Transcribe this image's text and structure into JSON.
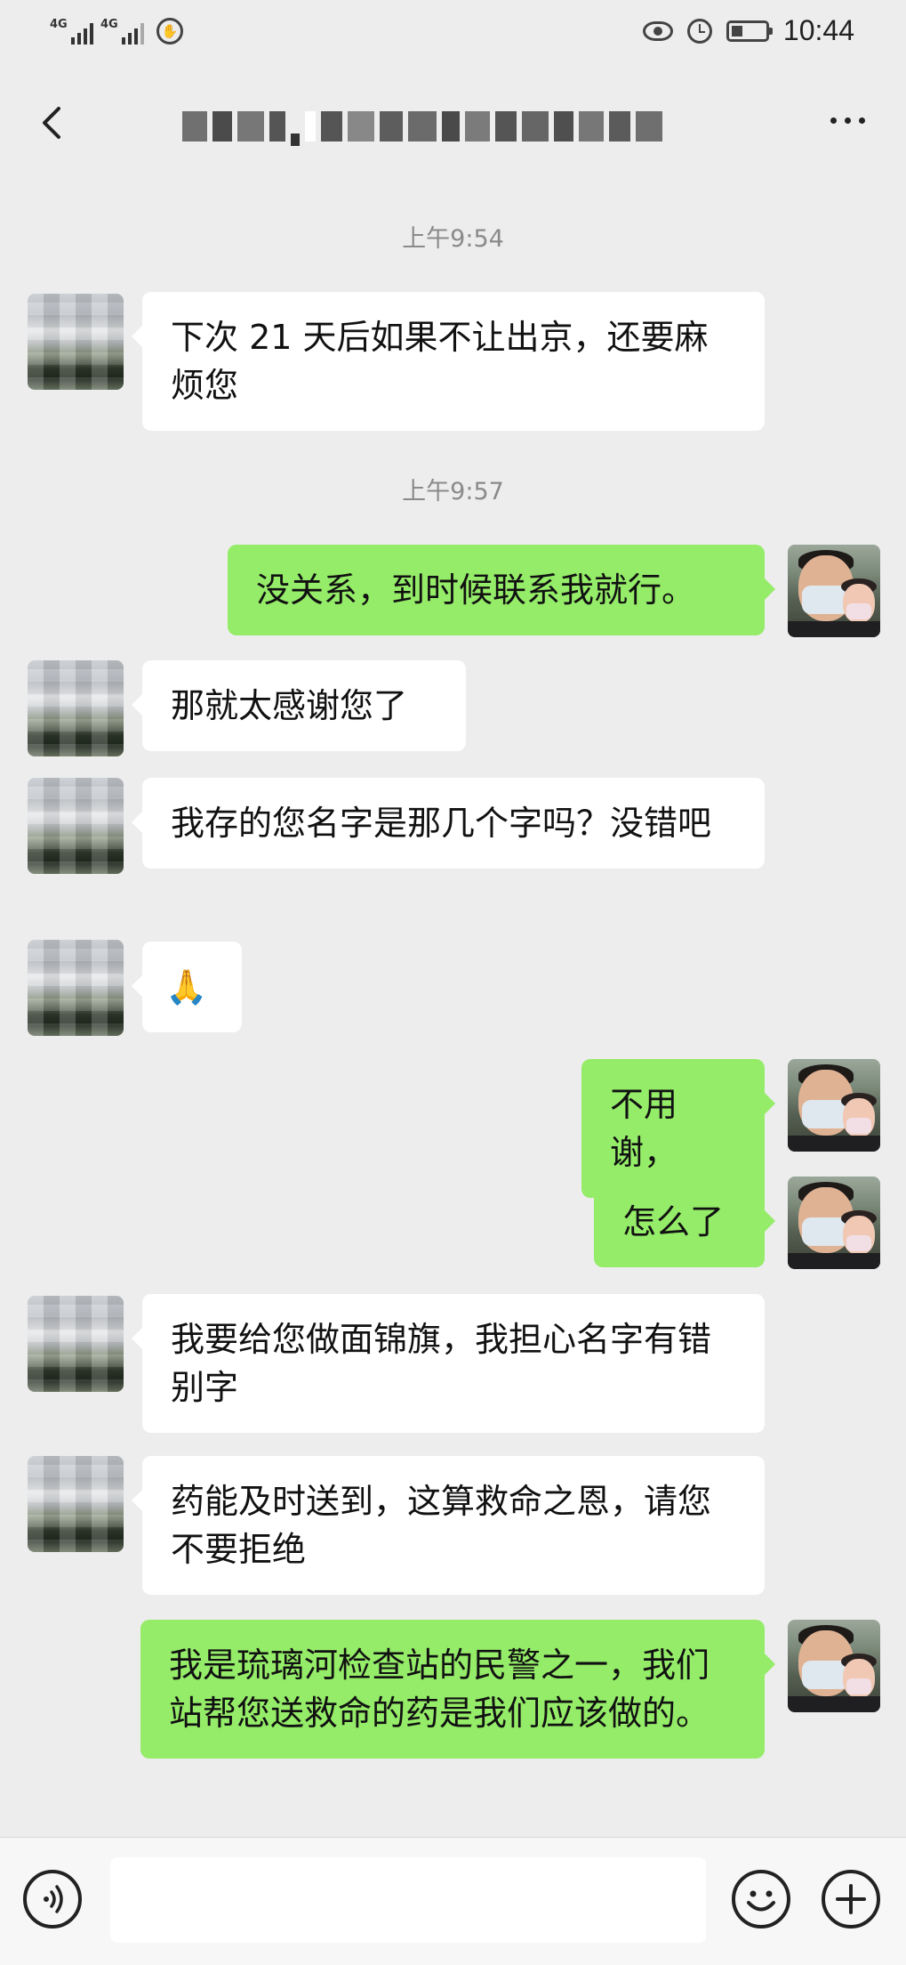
{
  "status_bar": {
    "network_1": "4G",
    "network_2": "4G",
    "time": "10:44"
  },
  "nav": {
    "title": "(blurred contact name)",
    "back_icon": "chevron-left-icon",
    "more_icon": "more-dots-icon"
  },
  "messages": [
    {
      "type": "time",
      "text": "上午9:54"
    },
    {
      "type": "msg",
      "side": "other",
      "text": "下次 21 天后如果不让出京，还要麻烦您"
    },
    {
      "type": "time",
      "text": "上午9:57"
    },
    {
      "type": "msg",
      "side": "self",
      "text": "没关系，到时候联系我就行。"
    },
    {
      "type": "msg",
      "side": "other",
      "text": "那就太感谢您了"
    },
    {
      "type": "msg",
      "side": "other",
      "text": "我存的您名字是那几个字吗？没错吧"
    },
    {
      "type": "msg",
      "side": "other",
      "text": "🙏"
    },
    {
      "type": "msg",
      "side": "self",
      "text": "不用谢，"
    },
    {
      "type": "msg",
      "side": "self",
      "text": "怎么了"
    },
    {
      "type": "msg",
      "side": "other",
      "text": "我要给您做面锦旗，我担心名字有错别字"
    },
    {
      "type": "msg",
      "side": "other",
      "text": "药能及时送到，这算救命之恩，请您不要拒绝"
    },
    {
      "type": "msg",
      "side": "self",
      "text": "我是琉璃河检查站的民警之一，我们站帮您送救命的药是我们应该做的。"
    }
  ],
  "input_bar": {
    "text_value": "",
    "voice_icon": "voice-icon",
    "emoji_icon": "emoji-icon",
    "plus_icon": "plus-icon"
  },
  "colors": {
    "background": "#ededed",
    "self_bubble": "#95ec69",
    "other_bubble": "#ffffff",
    "timestamp_text": "#8a8a8a"
  }
}
